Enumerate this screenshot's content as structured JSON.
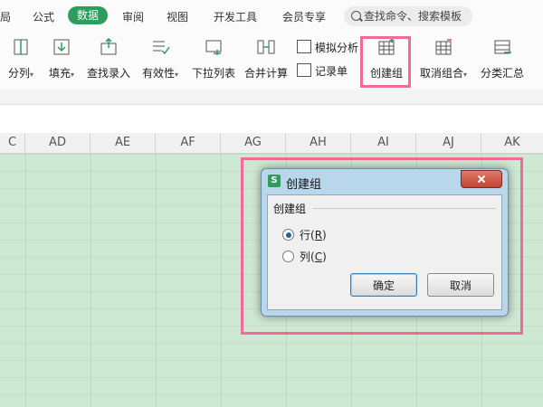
{
  "menu": {
    "items": [
      {
        "name": "menu-item-page-layout",
        "label": "局"
      },
      {
        "name": "menu-item-formula",
        "label": "公式"
      },
      {
        "name": "menu-item-review",
        "label": "审阅"
      },
      {
        "name": "menu-item-view",
        "label": "视图"
      },
      {
        "name": "menu-item-dev-tools",
        "label": "开发工具"
      },
      {
        "name": "menu-item-member",
        "label": "会员专享"
      }
    ],
    "active": "数据",
    "search_placeholder": "查找命令、搜索模板"
  },
  "ribbon": {
    "split_columns": "分列",
    "fill": "填充",
    "lookup_entry": "查找录入",
    "validity": "有效性",
    "dropdown_list": "下拉列表",
    "consolidate": "合并计算",
    "what_if": "模拟分析",
    "record_form": "记录单",
    "create_group": "创建组",
    "ungroup": "取消组合",
    "subtotal": "分类汇总"
  },
  "columns": [
    "C",
    "AD",
    "AE",
    "AF",
    "AG",
    "AH",
    "AI",
    "AJ",
    "AK"
  ],
  "dialog": {
    "title": "创建组",
    "group_label": "创建组",
    "row_option": {
      "text": "行(",
      "key": "R",
      "tail": ")"
    },
    "col_option": {
      "text": "列(",
      "key": "C",
      "tail": ")"
    },
    "ok": "确定",
    "cancel": "取消"
  },
  "colors": {
    "accent": "#2e9c5d",
    "highlight": "#f06b95",
    "grid": "#cfe8d3"
  }
}
